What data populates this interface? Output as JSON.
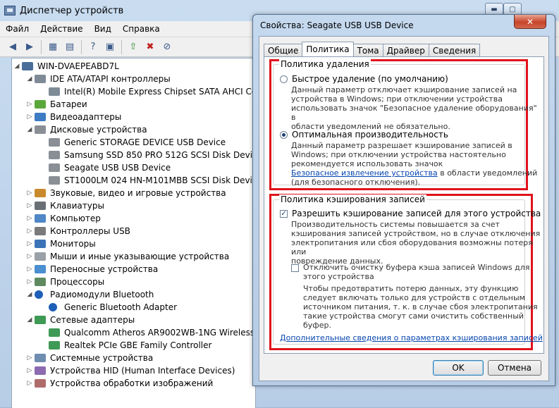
{
  "device_manager": {
    "title": "Диспетчер устройств",
    "menu": [
      "Файл",
      "Действие",
      "Вид",
      "Справка"
    ],
    "toolbar_icons": [
      "back-icon",
      "forward-icon",
      "properties-icon",
      "refresh-icon",
      "help-icon",
      "driver-icon",
      "update-driver-icon",
      "disable-icon",
      "uninstall-icon"
    ],
    "tree": [
      {
        "label": "WIN-DVAEPEABD7L",
        "level": 0,
        "expander": "◢",
        "icon": "computer-icon",
        "color": "c-host"
      },
      {
        "label": "IDE ATA/ATAPI контроллеры",
        "level": 1,
        "expander": "◢",
        "icon": "ide-controller-icon",
        "color": "c-ide"
      },
      {
        "label": "Intel(R) Mobile Express Chipset SATA AHCI Controller",
        "level": 2,
        "expander": "",
        "icon": "ide-controller-icon",
        "color": "c-ide"
      },
      {
        "label": "Батареи",
        "level": 1,
        "expander": "▷",
        "icon": "battery-icon",
        "color": "c-bat"
      },
      {
        "label": "Видеоадаптеры",
        "level": 1,
        "expander": "▷",
        "icon": "display-adapter-icon",
        "color": "c-vid"
      },
      {
        "label": "Дисковые устройства",
        "level": 1,
        "expander": "◢",
        "icon": "disk-drive-icon",
        "color": "c-disk"
      },
      {
        "label": "Generic STORAGE DEVICE USB Device",
        "level": 2,
        "expander": "",
        "icon": "disk-drive-icon",
        "color": "c-disk"
      },
      {
        "label": "Samsung SSD 850 PRO 512G SCSI Disk Device",
        "level": 2,
        "expander": "",
        "icon": "disk-drive-icon",
        "color": "c-disk"
      },
      {
        "label": "Seagate USB USB Device",
        "level": 2,
        "expander": "",
        "icon": "disk-drive-icon",
        "color": "c-disk"
      },
      {
        "label": "ST1000LM 024 HN-M101MBB SCSI Disk Device",
        "level": 2,
        "expander": "",
        "icon": "disk-drive-icon",
        "color": "c-disk"
      },
      {
        "label": "Звуковые, видео и игровые устройства",
        "level": 1,
        "expander": "▷",
        "icon": "sound-icon",
        "color": "c-snd"
      },
      {
        "label": "Клавиатуры",
        "level": 1,
        "expander": "▷",
        "icon": "keyboard-icon",
        "color": "c-kbd"
      },
      {
        "label": "Компьютер",
        "level": 1,
        "expander": "▷",
        "icon": "computer-icon",
        "color": "c-pc"
      },
      {
        "label": "Контроллеры USB",
        "level": 1,
        "expander": "▷",
        "icon": "usb-icon",
        "color": "c-usb"
      },
      {
        "label": "Мониторы",
        "level": 1,
        "expander": "▷",
        "icon": "monitor-icon",
        "color": "c-mon"
      },
      {
        "label": "Мыши и иные указывающие устройства",
        "level": 1,
        "expander": "▷",
        "icon": "mouse-icon",
        "color": "c-mouse"
      },
      {
        "label": "Переносные устройства",
        "level": 1,
        "expander": "▷",
        "icon": "portable-device-icon",
        "color": "c-port"
      },
      {
        "label": "Процессоры",
        "level": 1,
        "expander": "▷",
        "icon": "processor-icon",
        "color": "c-cpu"
      },
      {
        "label": "Радиомодули Bluetooth",
        "level": 1,
        "expander": "◢",
        "icon": "bluetooth-icon",
        "color": "c-bt"
      },
      {
        "label": "Generic Bluetooth Adapter",
        "level": 2,
        "expander": "",
        "icon": "bluetooth-icon",
        "color": "c-bt"
      },
      {
        "label": "Сетевые адаптеры",
        "level": 1,
        "expander": "◢",
        "icon": "network-adapter-icon",
        "color": "c-net"
      },
      {
        "label": "Qualcomm Atheros AR9002WB-1NG Wireless Network Adapter",
        "level": 2,
        "expander": "",
        "icon": "network-adapter-icon",
        "color": "c-net"
      },
      {
        "label": "Realtek PCIe GBE Family Controller",
        "level": 2,
        "expander": "",
        "icon": "network-adapter-icon",
        "color": "c-net"
      },
      {
        "label": "Системные устройства",
        "level": 1,
        "expander": "▷",
        "icon": "system-device-icon",
        "color": "c-sys"
      },
      {
        "label": "Устройства HID (Human Interface Devices)",
        "level": 1,
        "expander": "▷",
        "icon": "hid-icon",
        "color": "c-hid"
      },
      {
        "label": "Устройства обработки изображений",
        "level": 1,
        "expander": "▷",
        "icon": "imaging-device-icon",
        "color": "c-img"
      }
    ]
  },
  "dialog": {
    "title": "Свойства: Seagate USB USB Device",
    "close_label": "✕",
    "tabs": [
      {
        "label": "Общие",
        "active": false
      },
      {
        "label": "Политика",
        "active": true
      },
      {
        "label": "Тома",
        "active": false
      },
      {
        "label": "Драйвер",
        "active": false
      },
      {
        "label": "Сведения",
        "active": false
      }
    ],
    "removal_policy": {
      "group_title": "Политика удаления",
      "quick_removal": {
        "label": "Быстрое удаление (по умолчанию)",
        "selected": false,
        "desc": [
          "Данный параметр отключает кэширование записей на",
          "устройства в Windows; при отключении устройства",
          "использовать значок \"Безопасное удаление оборудования\" в",
          "области уведомлений не обязательно."
        ]
      },
      "better_performance": {
        "label": "Оптимальная производительность",
        "selected": true,
        "desc": [
          "Данный параметр разрешает кэширование записей в",
          "Windows; при отключении устройства настоятельно",
          "рекомендуется использовать значок"
        ],
        "link": "Безопасное извлечение устройства",
        "desc_after_link": " в области уведомлений",
        "desc_tail": "(для безопасного отключения)."
      }
    },
    "write_cache_policy": {
      "group_title": "Политика кэширования записей",
      "enable_write_cache": {
        "label": "Разрешить кэширование записей для этого устройства",
        "checked": true,
        "desc": [
          "Производительность системы повышается за счет",
          "кэширования записей устройством, но в случае отключения",
          "электропитания или сбоя оборудования возможны потеря или",
          "повреждение данных."
        ]
      },
      "turn_off_flushing": {
        "label": [
          "Отключить очистку буфера кэша записей Windows для",
          "этого устройства"
        ],
        "checked": false,
        "desc": [
          "Чтобы предотвратить потерю данных, эту функцию",
          "следует включать только для устройств с отдельным",
          "источником питания, т. к. в случае сбоя электропитания",
          "такие устройства смогут сами очистить собственный",
          "буфер."
        ]
      },
      "more_info_link": "Дополнительные сведения о параметрах кэширования записей"
    },
    "ok_label": "OK",
    "cancel_label": "Отмена"
  },
  "window_controls": {
    "minimize": "▬",
    "maximize": "▢",
    "close": "✕"
  },
  "highlight_color": "#e0121b"
}
